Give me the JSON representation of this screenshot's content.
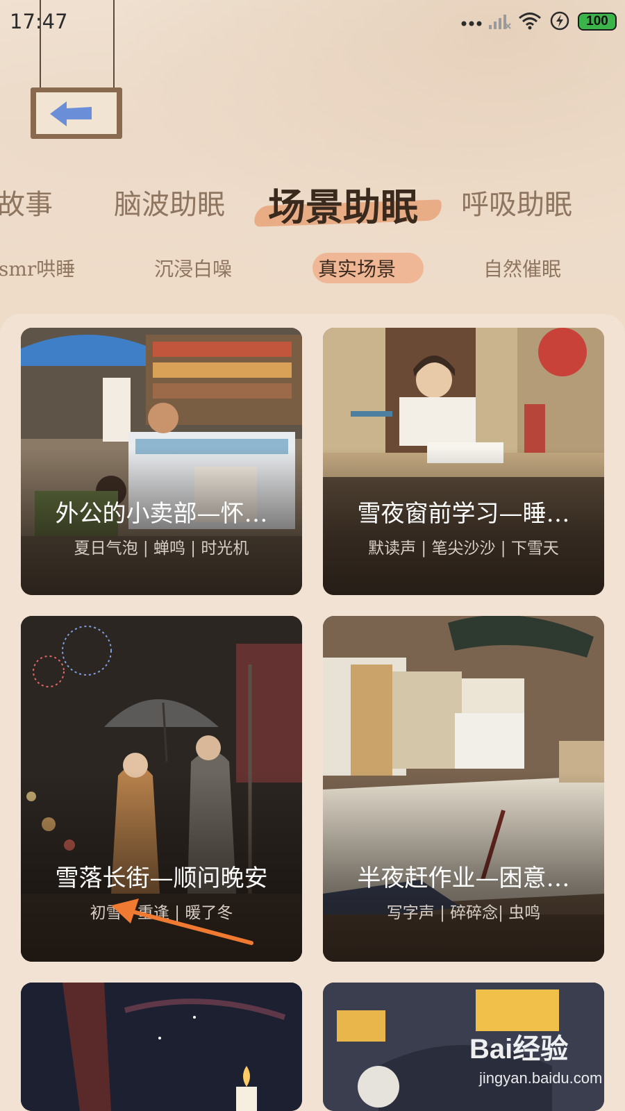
{
  "status_bar": {
    "time": "17:47",
    "battery": "100",
    "icons": [
      "more-dots-icon",
      "signal-icon",
      "wifi-icon",
      "charging-icon",
      "battery-icon"
    ]
  },
  "back": {
    "icon": "arrow-left-icon"
  },
  "main_tabs": [
    {
      "label": "故事"
    },
    {
      "label": "脑波助眠"
    },
    {
      "label": "场景助眠",
      "active": true
    },
    {
      "label": "呼吸助眠"
    }
  ],
  "sub_tabs": [
    {
      "label": "smr哄睡"
    },
    {
      "label": "沉浸白噪"
    },
    {
      "label": "真实场景",
      "active": true
    },
    {
      "label": "自然催眠"
    }
  ],
  "cards": [
    {
      "title": "外公的小卖部—怀…",
      "tags": "夏日气泡 | 蝉鸣 | 时光机"
    },
    {
      "title": "雪夜窗前学习—睡…",
      "tags": "默读声 | 笔尖沙沙 | 下雪天"
    },
    {
      "title": "雪落长街—顺问晚安",
      "tags": "初雪 | 重逢 | 暖了冬"
    },
    {
      "title": "半夜赶作业—困意…",
      "tags": "写字声 | 碎碎念| 虫鸣"
    }
  ],
  "watermark": {
    "logo": "Bai经验",
    "url": "jingyan.baidu.com"
  },
  "colors": {
    "background": "#ecdccb",
    "panel": "#f1e2d4",
    "accent": "#e8a47a",
    "tab_inactive": "#8e7560",
    "tab_active": "#3a2a1e",
    "annotation_arrow": "#f07a32"
  }
}
